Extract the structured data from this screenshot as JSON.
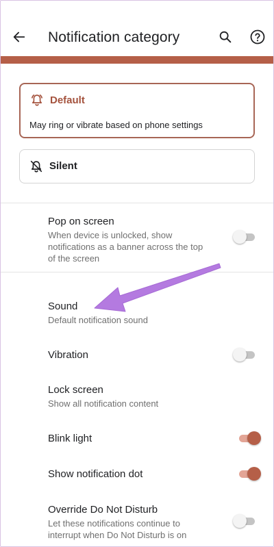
{
  "header": {
    "title": "Notification category",
    "back_icon": "arrow-back-icon",
    "search_icon": "search-icon",
    "help_icon": "help-icon"
  },
  "options": {
    "default": {
      "label": "Default",
      "description": "May ring or vibrate based on phone settings",
      "icon": "bell-ring-icon",
      "selected": true
    },
    "silent": {
      "label": "Silent",
      "icon": "bell-off-icon",
      "selected": false
    }
  },
  "settings": {
    "pop_on_screen": {
      "title": "Pop on screen",
      "line1": "When device is unlocked, show",
      "line2": "notifications as a banner across the top",
      "line3": "of the screen",
      "enabled": false
    },
    "sound": {
      "title": "Sound",
      "subtitle": "Default notification sound"
    },
    "vibration": {
      "title": "Vibration",
      "enabled": false
    },
    "lock_screen": {
      "title": "Lock screen",
      "subtitle": "Show all notification content"
    },
    "blink_light": {
      "title": "Blink light",
      "enabled": true
    },
    "notification_dot": {
      "title": "Show notification dot",
      "enabled": true
    },
    "override_dnd": {
      "title": "Override Do Not Disturb",
      "line1": "Let these notifications continue to",
      "line2": "interrupt when Do Not Disturb is on",
      "enabled": false
    }
  },
  "colors": {
    "accent": "#b55f48",
    "accent_light": "#e3a596",
    "annotation_arrow": "#b47ae0"
  }
}
